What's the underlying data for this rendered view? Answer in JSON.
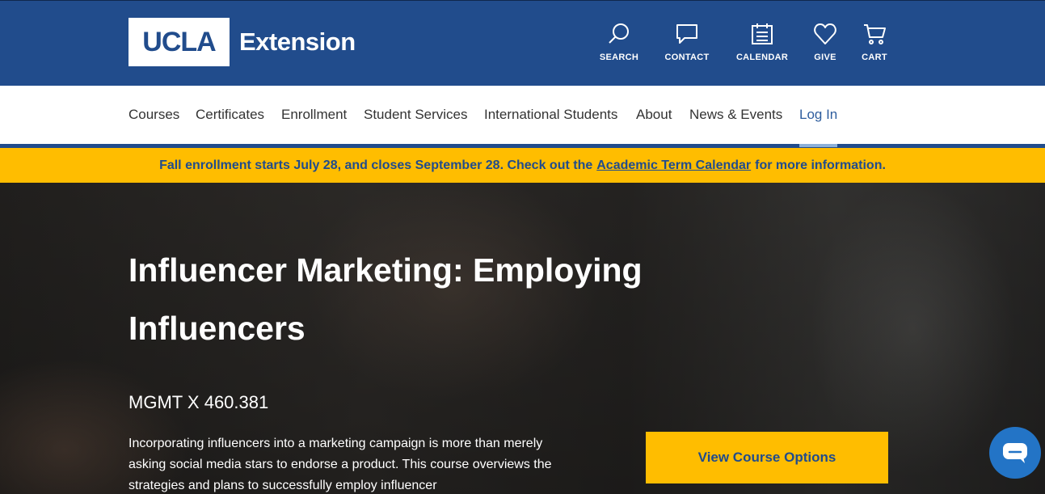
{
  "header": {
    "logo_ucla": "UCLA",
    "logo_extension": "Extension",
    "utilities": [
      {
        "label": "SEARCH",
        "icon": "search-icon"
      },
      {
        "label": "CONTACT",
        "icon": "chat-bubble-icon"
      },
      {
        "label": "CALENDAR",
        "icon": "calendar-icon"
      },
      {
        "label": "GIVE",
        "icon": "heart-icon"
      },
      {
        "label": "CART",
        "icon": "cart-icon"
      }
    ]
  },
  "nav": {
    "items": [
      "Courses",
      "Certificates",
      "Enrollment",
      "Student Services",
      "International Students",
      "About",
      "News & Events",
      "Log In"
    ]
  },
  "alert": {
    "text_before": "Fall enrollment starts July 28, and closes September 28. Check out the",
    "link": "Academic Term Calendar",
    "text_after": "for more information."
  },
  "hero": {
    "title": "Influencer Marketing: Employing Influencers",
    "course_code": "MGMT X 460.381",
    "description": "Incorporating influencers into a marketing campaign is more than merely asking social media stars to endorse a product. This course overviews the strategies and plans to successfully employ influencer",
    "cta_label": "View Course Options"
  },
  "colors": {
    "brand_blue": "#214c8c",
    "gold": "#ffbd00",
    "chat_blue": "#2374c6"
  }
}
